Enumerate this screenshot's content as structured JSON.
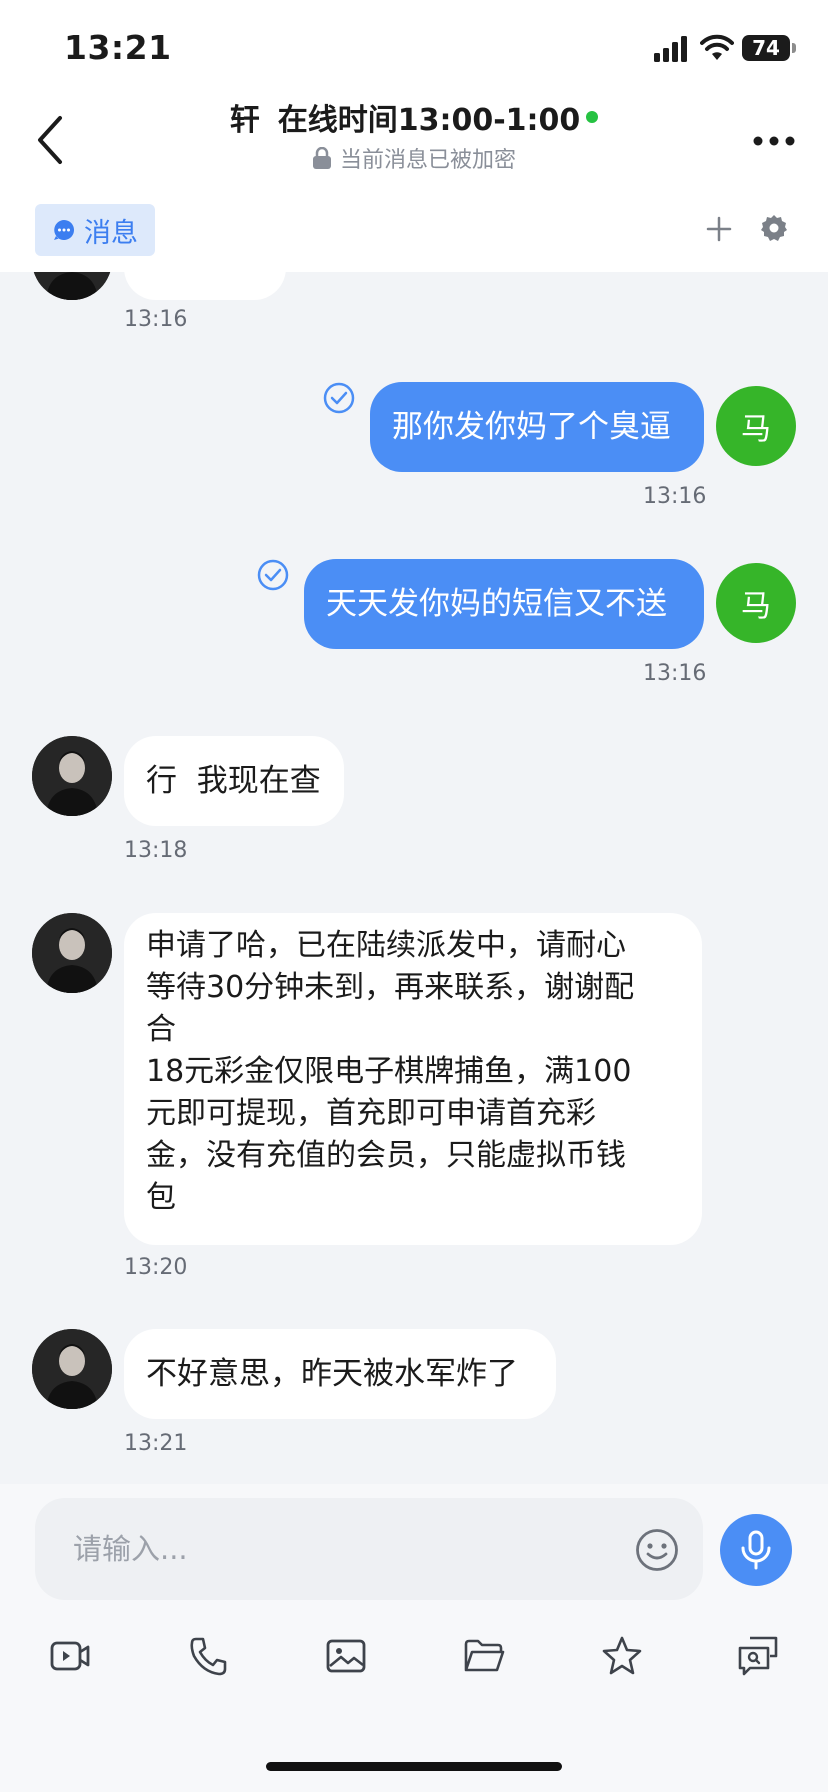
{
  "status_bar": {
    "time": "13:21",
    "battery": "74"
  },
  "header": {
    "name": "轩",
    "status_text": "在线时间13:00-1:00",
    "encryption_note": "当前消息已被加密"
  },
  "tabs": {
    "messages_label": "消息"
  },
  "messages": [
    {
      "from": "contact",
      "time": "13:16",
      "text": ""
    },
    {
      "from": "me",
      "avatar_text": "马",
      "text": "那你发你妈了个臭逼",
      "time": "13:16",
      "read": true
    },
    {
      "from": "me",
      "avatar_text": "马",
      "text": "天天发你妈的短信又不送",
      "time": "13:16",
      "read": true
    },
    {
      "from": "contact",
      "text": "行  我现在查",
      "time": "13:18"
    },
    {
      "from": "contact",
      "lines": [
        "申请了哈，已在陆续派发中，请耐心",
        "等待30分钟未到，再来联系，谢谢配",
        "合",
        "18元彩金仅限电子棋牌捕鱼，满100",
        "元即可提现，首充即可申请首充彩",
        "金，没有充值的会员，只能虚拟币钱",
        "包"
      ],
      "time": "13:20"
    },
    {
      "from": "contact",
      "text": "不好意思，昨天被水军炸了",
      "time": "13:21"
    }
  ],
  "input": {
    "placeholder": "请输入..."
  },
  "toolbar": {
    "icons": [
      "video-icon",
      "phone-icon",
      "image-icon",
      "folder-icon",
      "star-icon",
      "chat-search-icon"
    ]
  },
  "colors": {
    "accent": "#4b8ef5",
    "my_avatar": "#36b529",
    "online": "#26c242"
  }
}
